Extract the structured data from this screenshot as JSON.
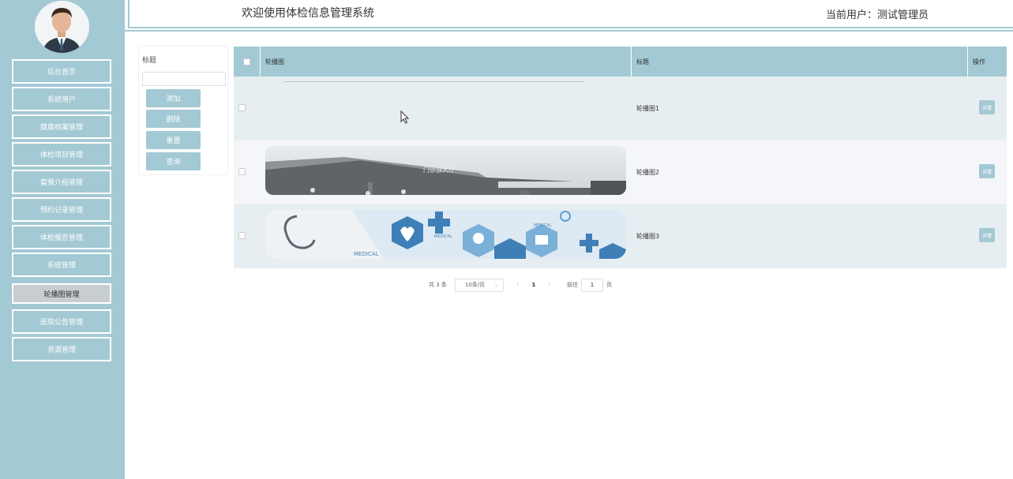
{
  "header": {
    "system_title": "欢迎使用体检信息管理系统",
    "current_user": "当前用户：测试管理员"
  },
  "sidebar": {
    "items": [
      {
        "label": "后台首页"
      },
      {
        "label": "系统用户"
      },
      {
        "label": "健康档案管理"
      },
      {
        "label": "体检项目管理"
      },
      {
        "label": "套餐介绍管理"
      },
      {
        "label": "预约记录管理"
      },
      {
        "label": "体检报告管理"
      },
      {
        "label": "系统管理"
      },
      {
        "label": "轮播图管理",
        "active": true
      },
      {
        "label": "医院公告管理"
      },
      {
        "label": "资源管理"
      }
    ]
  },
  "search": {
    "title_label": "标题",
    "title_value": "",
    "buttons": {
      "add": "添加",
      "delete": "删除",
      "reset": "重置",
      "query": "查询"
    }
  },
  "table": {
    "columns": {
      "image": "轮播图",
      "title": "标题",
      "action": "操作"
    },
    "rows": [
      {
        "title": "轮播图1",
        "image": "blank",
        "action": "详情"
      },
      {
        "title": "轮播图2",
        "image": "hospital-corridor",
        "action": "详情"
      },
      {
        "title": "轮播图3",
        "image": "medical-icons",
        "action": "详情"
      }
    ],
    "image_text": {
      "row2_sign": "门诊部大厅",
      "row3_label_a": "MEDICAL",
      "row3_label_b": "MEDICAL",
      "row3_label_c": "MEDICAL"
    }
  },
  "pagination": {
    "total_text": "共 3 条",
    "page_size": "10条/页",
    "prev_icon": "chevron-left-icon",
    "current_page": "1",
    "next_icon": "chevron-right-icon",
    "goto_label": "前往",
    "goto_value": "1",
    "goto_suffix": "页"
  },
  "colors": {
    "sidebar_bg": "#a3c9d4",
    "accent": "#a3c9d4",
    "row_alt": "#f4f6f9",
    "row_base": "#e7eef1"
  }
}
